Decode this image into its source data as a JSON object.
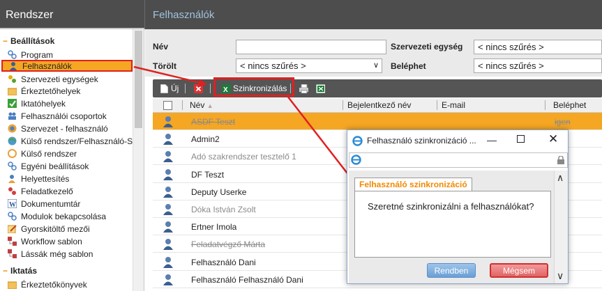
{
  "left_header": {
    "title": "Rendszer"
  },
  "main_header": {
    "title": "Felhasználók"
  },
  "sidebar": {
    "sections": [
      {
        "label": "Beállítások"
      },
      {
        "label": "Iktatás"
      }
    ],
    "items": [
      {
        "label": "Program",
        "icon": "gear-link-icon"
      },
      {
        "label": "Felhasználók",
        "icon": "user-icon"
      },
      {
        "label": "Szervezeti egységek",
        "icon": "org-icon"
      },
      {
        "label": "Érkeztetőhelyek",
        "icon": "folder-icon"
      },
      {
        "label": "Iktatóhelyek",
        "icon": "check-icon"
      },
      {
        "label": "Felhasználói csoportok",
        "icon": "group-icon"
      },
      {
        "label": "Szervezet - felhasználó",
        "icon": "globe-icon"
      },
      {
        "label": "Külső rendszer/Felhasználó-Sze",
        "icon": "globe-icon"
      },
      {
        "label": "Külső rendszer",
        "icon": "circle-icon"
      },
      {
        "label": "Egyéni beállítások",
        "icon": "gear-link-icon"
      },
      {
        "label": "Helyettesítés",
        "icon": "user-icon"
      },
      {
        "label": "Feladatkezelő",
        "icon": "task-icon"
      },
      {
        "label": "Dokumentumtár",
        "icon": "word-icon"
      },
      {
        "label": "Modulok bekapcsolása",
        "icon": "gear-link-icon"
      },
      {
        "label": "Gyorskitöltő mezői",
        "icon": "edit-icon"
      },
      {
        "label": "Workflow sablon",
        "icon": "workflow-icon"
      },
      {
        "label": "Lássák még sablon",
        "icon": "workflow-icon"
      }
    ],
    "iktatas_items": [
      {
        "label": "Érkeztetőkönyvek",
        "icon": "folder-icon"
      }
    ]
  },
  "filter": {
    "nev_label": "Név",
    "nev_value": "",
    "torolt_label": "Törölt",
    "torolt_value": "< nincs szűrés >",
    "szerv_label": "Szervezeti egység",
    "szerv_value": "< nincs szűrés >",
    "belephet_label": "Beléphet",
    "belephet_value": "< nincs szűrés >"
  },
  "toolbar": {
    "new_label": "Új",
    "sync_label": "Szinkronizálás"
  },
  "grid": {
    "columns": [
      "Név",
      "Bejelentkező név",
      "E-mail",
      "Beléphet"
    ],
    "rows": [
      {
        "name": "ASDF Teszt",
        "style": "strike",
        "extra": "igen"
      },
      {
        "name": "Admin2",
        "style": "normal"
      },
      {
        "name": "Adó szakrendszer tesztelő 1",
        "style": "grey"
      },
      {
        "name": "DF Teszt",
        "style": "normal"
      },
      {
        "name": "Deputy Userke",
        "style": "normal"
      },
      {
        "name": "Dóka István Zsolt",
        "style": "grey"
      },
      {
        "name": "Ertner Imola",
        "style": "normal"
      },
      {
        "name": "Feladatvégző Márta",
        "style": "strike"
      },
      {
        "name": "Felhasználó Dani",
        "style": "normal"
      },
      {
        "name": "Felhasználó Felhasználó Dani",
        "style": "normal"
      }
    ]
  },
  "dialog": {
    "title": "Felhasználó szinkronizáció ...",
    "panel_title": "Felhasználó szinkronizáció",
    "message": "Szeretné szinkronizálni a felhasználókat?",
    "ok_label": "Rendben",
    "cancel_label": "Mégsem"
  },
  "colors": {
    "header_bg": "#4d4d4d",
    "selection": "#f5a623",
    "highlight": "#e02020",
    "accent_orange": "#f08a00"
  }
}
